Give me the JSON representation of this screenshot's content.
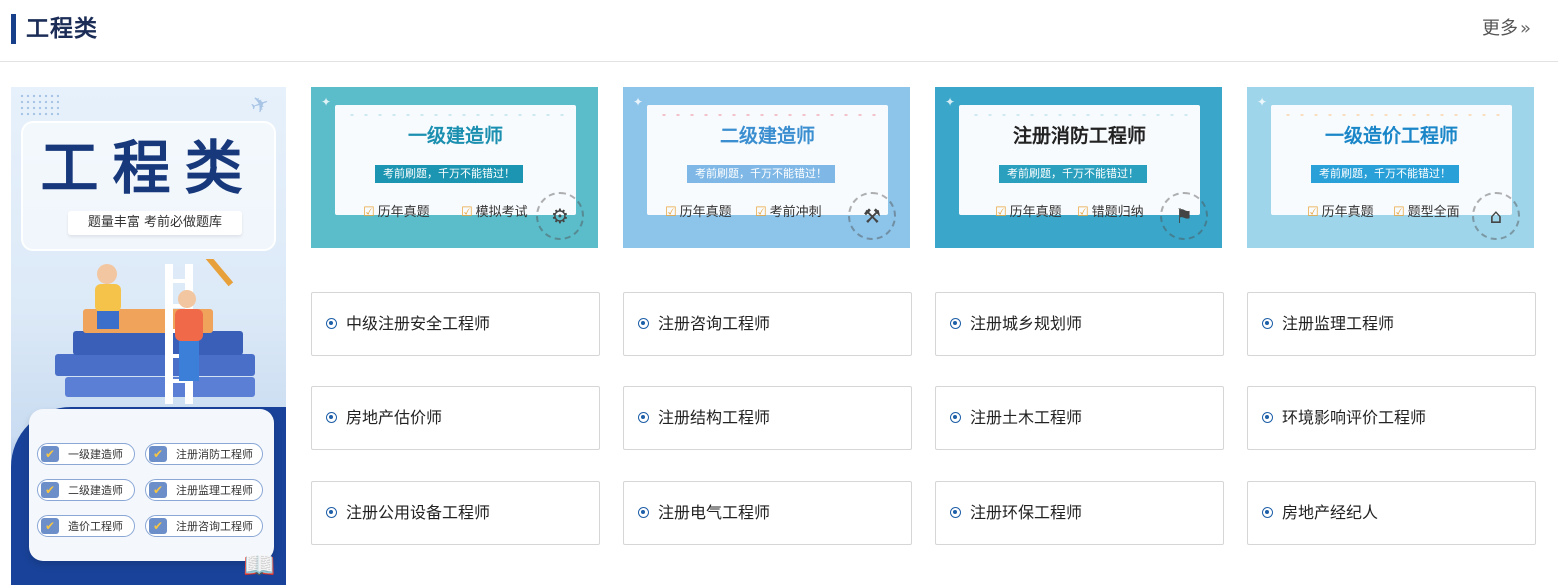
{
  "header": {
    "title": "工程类",
    "more_label": "更多",
    "more_icon": "double-chevron-right-icon"
  },
  "banner": {
    "title": "工程类",
    "tagline": "题量丰富  考前必做题库",
    "pills": [
      "一级建造师",
      "注册消防工程师",
      "二级建造师",
      "注册监理工程师",
      "造价工程师",
      "注册咨询工程师"
    ]
  },
  "cards": [
    {
      "title": "一级建造师",
      "slogan": "考前刷题，千万不能错过！",
      "features": [
        "历年真题",
        "模拟考试"
      ],
      "bg": "#5bbcca",
      "title_color": "#1b8fb0",
      "slogan_bg": "#1b95b1",
      "dot": "#9fd6e2"
    },
    {
      "title": "二级建造师",
      "slogan": "考前刷题，千万不能错过！",
      "features": [
        "历年真题",
        "考前冲刺"
      ],
      "bg": "#8dc4ea",
      "title_color": "#3b8fd0",
      "slogan_bg": "#7fb8e6",
      "dot": "#f08a95"
    },
    {
      "title": "注册消防工程师",
      "slogan": "考前刷题，千万不能错过！",
      "features": [
        "历年真题",
        "错题归纳"
      ],
      "bg": "#3aa7ca",
      "title_color": "#222222",
      "slogan_bg": "#2aa0be",
      "dot": "#a8d8e8"
    },
    {
      "title": "一级造价工程师",
      "slogan": "考前刷题，千万不能错过！",
      "features": [
        "历年真题",
        "题型全面"
      ],
      "bg": "#9fd5ea",
      "title_color": "#1a86c8",
      "slogan_bg": "#2aa0d8",
      "dot": "#f6c27e"
    }
  ],
  "exams": [
    "中级注册安全工程师",
    "注册咨询工程师",
    "注册城乡规划师",
    "注册监理工程师",
    "房地产估价师",
    "注册结构工程师",
    "注册土木工程师",
    "环境影响评价工程师",
    "注册公用设备工程师",
    "注册电气工程师",
    "注册环保工程师",
    "房地产经纪人"
  ]
}
